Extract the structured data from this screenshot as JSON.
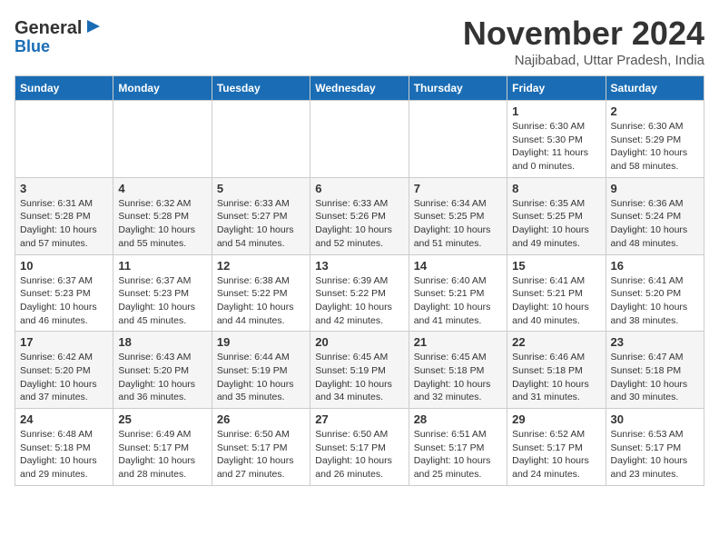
{
  "header": {
    "logo_line1": "General",
    "logo_line2": "Blue",
    "month_title": "November 2024",
    "subtitle": "Najibabad, Uttar Pradesh, India"
  },
  "weekdays": [
    "Sunday",
    "Monday",
    "Tuesday",
    "Wednesday",
    "Thursday",
    "Friday",
    "Saturday"
  ],
  "weeks": [
    [
      {
        "day": "",
        "info": ""
      },
      {
        "day": "",
        "info": ""
      },
      {
        "day": "",
        "info": ""
      },
      {
        "day": "",
        "info": ""
      },
      {
        "day": "",
        "info": ""
      },
      {
        "day": "1",
        "info": "Sunrise: 6:30 AM\nSunset: 5:30 PM\nDaylight: 11 hours\nand 0 minutes."
      },
      {
        "day": "2",
        "info": "Sunrise: 6:30 AM\nSunset: 5:29 PM\nDaylight: 10 hours\nand 58 minutes."
      }
    ],
    [
      {
        "day": "3",
        "info": "Sunrise: 6:31 AM\nSunset: 5:28 PM\nDaylight: 10 hours\nand 57 minutes."
      },
      {
        "day": "4",
        "info": "Sunrise: 6:32 AM\nSunset: 5:28 PM\nDaylight: 10 hours\nand 55 minutes."
      },
      {
        "day": "5",
        "info": "Sunrise: 6:33 AM\nSunset: 5:27 PM\nDaylight: 10 hours\nand 54 minutes."
      },
      {
        "day": "6",
        "info": "Sunrise: 6:33 AM\nSunset: 5:26 PM\nDaylight: 10 hours\nand 52 minutes."
      },
      {
        "day": "7",
        "info": "Sunrise: 6:34 AM\nSunset: 5:25 PM\nDaylight: 10 hours\nand 51 minutes."
      },
      {
        "day": "8",
        "info": "Sunrise: 6:35 AM\nSunset: 5:25 PM\nDaylight: 10 hours\nand 49 minutes."
      },
      {
        "day": "9",
        "info": "Sunrise: 6:36 AM\nSunset: 5:24 PM\nDaylight: 10 hours\nand 48 minutes."
      }
    ],
    [
      {
        "day": "10",
        "info": "Sunrise: 6:37 AM\nSunset: 5:23 PM\nDaylight: 10 hours\nand 46 minutes."
      },
      {
        "day": "11",
        "info": "Sunrise: 6:37 AM\nSunset: 5:23 PM\nDaylight: 10 hours\nand 45 minutes."
      },
      {
        "day": "12",
        "info": "Sunrise: 6:38 AM\nSunset: 5:22 PM\nDaylight: 10 hours\nand 44 minutes."
      },
      {
        "day": "13",
        "info": "Sunrise: 6:39 AM\nSunset: 5:22 PM\nDaylight: 10 hours\nand 42 minutes."
      },
      {
        "day": "14",
        "info": "Sunrise: 6:40 AM\nSunset: 5:21 PM\nDaylight: 10 hours\nand 41 minutes."
      },
      {
        "day": "15",
        "info": "Sunrise: 6:41 AM\nSunset: 5:21 PM\nDaylight: 10 hours\nand 40 minutes."
      },
      {
        "day": "16",
        "info": "Sunrise: 6:41 AM\nSunset: 5:20 PM\nDaylight: 10 hours\nand 38 minutes."
      }
    ],
    [
      {
        "day": "17",
        "info": "Sunrise: 6:42 AM\nSunset: 5:20 PM\nDaylight: 10 hours\nand 37 minutes."
      },
      {
        "day": "18",
        "info": "Sunrise: 6:43 AM\nSunset: 5:20 PM\nDaylight: 10 hours\nand 36 minutes."
      },
      {
        "day": "19",
        "info": "Sunrise: 6:44 AM\nSunset: 5:19 PM\nDaylight: 10 hours\nand 35 minutes."
      },
      {
        "day": "20",
        "info": "Sunrise: 6:45 AM\nSunset: 5:19 PM\nDaylight: 10 hours\nand 34 minutes."
      },
      {
        "day": "21",
        "info": "Sunrise: 6:45 AM\nSunset: 5:18 PM\nDaylight: 10 hours\nand 32 minutes."
      },
      {
        "day": "22",
        "info": "Sunrise: 6:46 AM\nSunset: 5:18 PM\nDaylight: 10 hours\nand 31 minutes."
      },
      {
        "day": "23",
        "info": "Sunrise: 6:47 AM\nSunset: 5:18 PM\nDaylight: 10 hours\nand 30 minutes."
      }
    ],
    [
      {
        "day": "24",
        "info": "Sunrise: 6:48 AM\nSunset: 5:18 PM\nDaylight: 10 hours\nand 29 minutes."
      },
      {
        "day": "25",
        "info": "Sunrise: 6:49 AM\nSunset: 5:17 PM\nDaylight: 10 hours\nand 28 minutes."
      },
      {
        "day": "26",
        "info": "Sunrise: 6:50 AM\nSunset: 5:17 PM\nDaylight: 10 hours\nand 27 minutes."
      },
      {
        "day": "27",
        "info": "Sunrise: 6:50 AM\nSunset: 5:17 PM\nDaylight: 10 hours\nand 26 minutes."
      },
      {
        "day": "28",
        "info": "Sunrise: 6:51 AM\nSunset: 5:17 PM\nDaylight: 10 hours\nand 25 minutes."
      },
      {
        "day": "29",
        "info": "Sunrise: 6:52 AM\nSunset: 5:17 PM\nDaylight: 10 hours\nand 24 minutes."
      },
      {
        "day": "30",
        "info": "Sunrise: 6:53 AM\nSunset: 5:17 PM\nDaylight: 10 hours\nand 23 minutes."
      }
    ]
  ]
}
